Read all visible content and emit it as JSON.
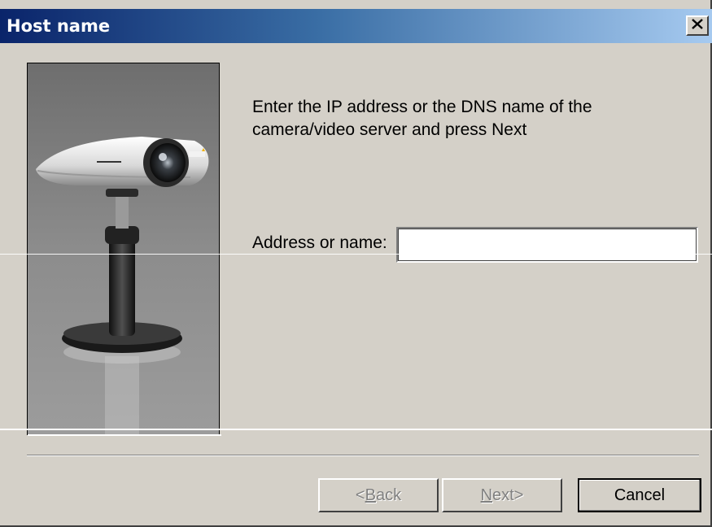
{
  "window": {
    "title": "Host name",
    "close_icon": "close-x-icon"
  },
  "content": {
    "instruction": "Enter the IP address or the DNS name of the camera/video server and press Next",
    "address_label": "Address or name:",
    "address_value": "",
    "image": "network-camera-illustration",
    "camera_brand": "AXIS"
  },
  "buttons": {
    "back": {
      "accel": "B",
      "rest": "ack",
      "prefix": "< ",
      "suffix": ""
    },
    "next": {
      "accel": "N",
      "rest": "ext",
      "prefix": "",
      "suffix": " >"
    },
    "cancel": "Cancel"
  },
  "colors": {
    "title_gradient_start": "#0a246a",
    "title_gradient_end": "#a6caf0",
    "dialog_background": "#d4d0c8"
  }
}
